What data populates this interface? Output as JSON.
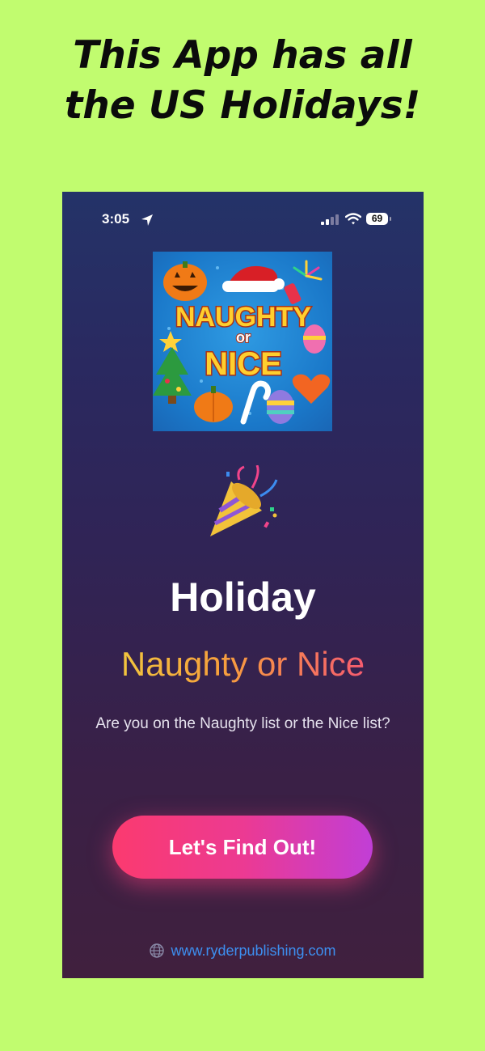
{
  "promo": {
    "line1": "This App has all",
    "line2": "the US Holidays!"
  },
  "status_bar": {
    "time": "3:05",
    "battery": "69",
    "icons": [
      "location-arrow-icon",
      "signal-icon",
      "wifi-icon",
      "battery-icon"
    ]
  },
  "artwork": {
    "line1": "NAUGHTY",
    "line2": "or",
    "line3": "NICE",
    "icons": [
      "pumpkin-face-icon",
      "santa-hat-icon",
      "firework-icon",
      "star-icon",
      "christmas-tree-icon",
      "pumpkin-icon",
      "candy-cane-icon",
      "easter-egg-icon",
      "heart-icon"
    ]
  },
  "party_icon": "party-popper-icon",
  "title": "Holiday",
  "subtitle": "Naughty or Nice",
  "tagline": "Are you on the Naughty list or the Nice list?",
  "cta": {
    "label": "Let's Find Out!"
  },
  "footer": {
    "icon": "globe-icon",
    "link": "www.ryderpublishing.com"
  },
  "colors": {
    "page_background": "#c1fc6f",
    "phone_top": "#243368",
    "phone_bottom": "#40203e",
    "cta_start": "#fb3a6f",
    "cta_end": "#c13ed6",
    "link": "#3d8ff0"
  }
}
